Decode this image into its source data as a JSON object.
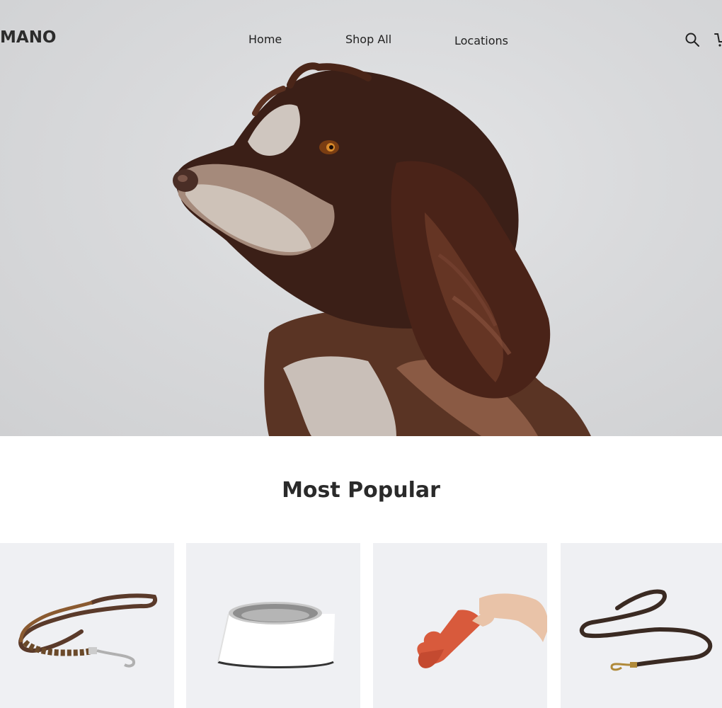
{
  "brand": {
    "logo_text": "MANO"
  },
  "nav": {
    "items": [
      {
        "label": "Home"
      },
      {
        "label": "Shop All"
      },
      {
        "label": "Locations"
      }
    ]
  },
  "header_icons": [
    "search-icon",
    "cart-icon"
  ],
  "hero": {
    "image": "brown-and-white-spaniel-dog-portrait"
  },
  "section": {
    "title": "Most Popular"
  },
  "products": [
    {
      "image": "braided-leather-leash"
    },
    {
      "image": "white-steel-dog-bowl"
    },
    {
      "image": "red-rope-bone-toy-in-hand"
    },
    {
      "image": "dark-brown-leather-leash"
    }
  ],
  "colors": {
    "hero_background": "#d9dadc",
    "card_background": "#eff0f3",
    "text": "#2a2a2a"
  }
}
